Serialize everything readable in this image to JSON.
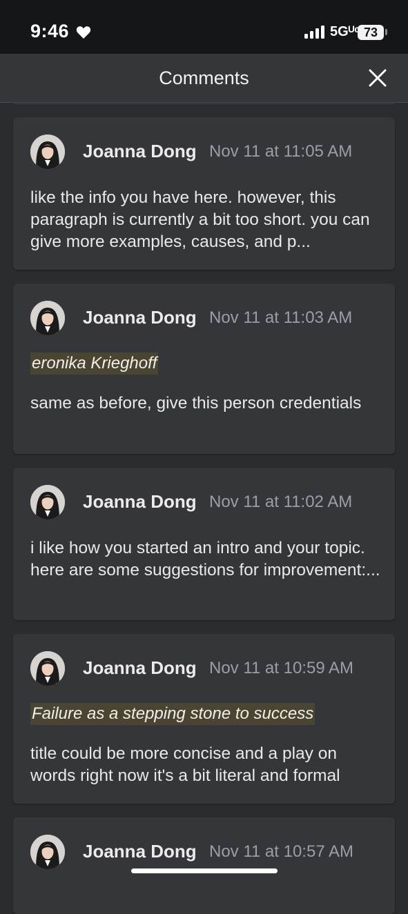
{
  "status_bar": {
    "time": "9:46",
    "network": "5Gᵁᶜ",
    "battery": "73"
  },
  "header": {
    "title": "Comments"
  },
  "comments": [
    {
      "author": "Joanna Dong",
      "timestamp": "Nov 11 at 11:05 AM",
      "quote": "",
      "text": "like the info you have here. however, this paragraph is currently a bit too short. you can give more examples, causes, and p..."
    },
    {
      "author": "Joanna Dong",
      "timestamp": "Nov 11 at 11:03 AM",
      "quote": "eronika Krieghoff",
      "text": "same as before, give this person credentials"
    },
    {
      "author": "Joanna Dong",
      "timestamp": "Nov 11 at 11:02 AM",
      "quote": "",
      "text": "i like how you started an intro and your topic. here are some suggestions for improvement:..."
    },
    {
      "author": "Joanna Dong",
      "timestamp": "Nov 11 at 10:59 AM",
      "quote": "Failure as a stepping stone to success",
      "text": "title could be more concise and a play on words right now it's a bit literal and formal"
    },
    {
      "author": "Joanna Dong",
      "timestamp": "Nov 11 at 10:57 AM",
      "quote": "",
      "text": ""
    }
  ],
  "icons": {
    "heart": "heart-icon",
    "signal": "cellular-signal-icon",
    "close": "close-icon"
  },
  "colors": {
    "background": "#2b2c30",
    "card": "#35363a",
    "highlight": "#4a4533"
  }
}
